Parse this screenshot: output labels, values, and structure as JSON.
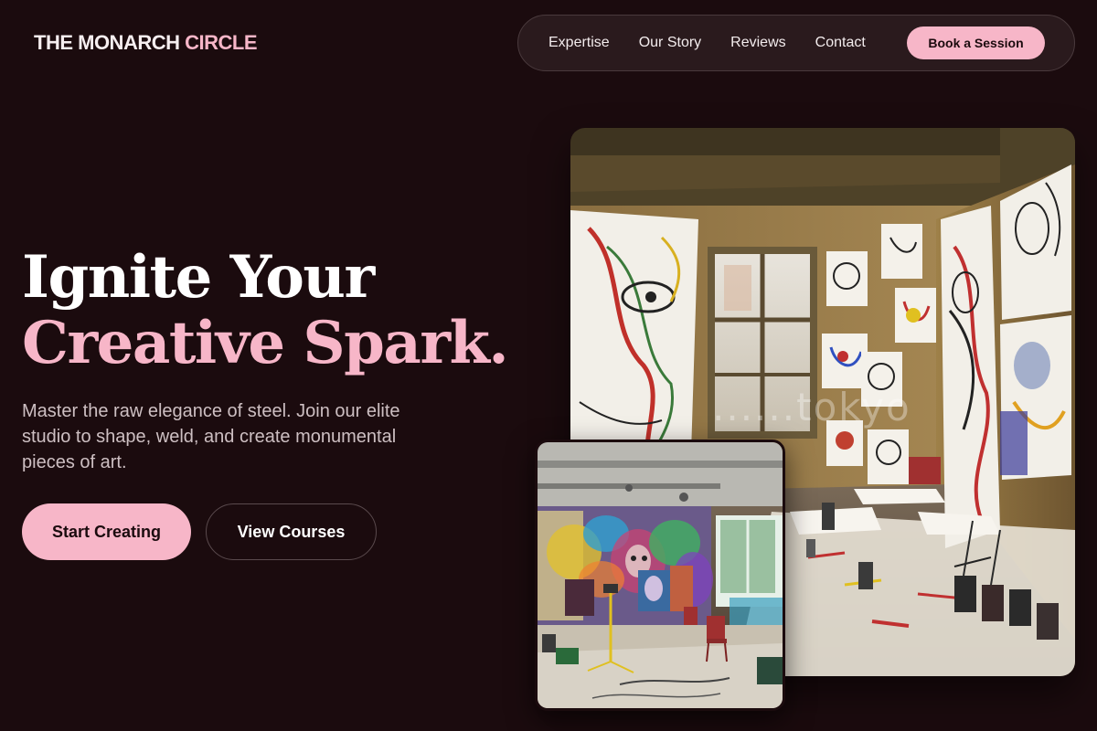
{
  "brand": {
    "name_main": "THE MONARCH",
    "name_accent": "CIRCLE"
  },
  "nav": {
    "links": [
      "Expertise",
      "Our Story",
      "Reviews",
      "Contact"
    ],
    "cta": "Book a Session"
  },
  "hero": {
    "title_line1": "Ignite Your",
    "title_line2": "Creative Spark.",
    "subtitle": "Master the raw elegance of steel. Join our elite studio to shape, weld, and create monumental pieces of art.",
    "primary_button": "Start Creating",
    "secondary_button": "View Courses"
  },
  "images": {
    "main_watermark": "......tokyo"
  },
  "colors": {
    "background": "#1b0b0e",
    "accent": "#f7b6c8",
    "nav_bg": "#2a1a1d"
  }
}
